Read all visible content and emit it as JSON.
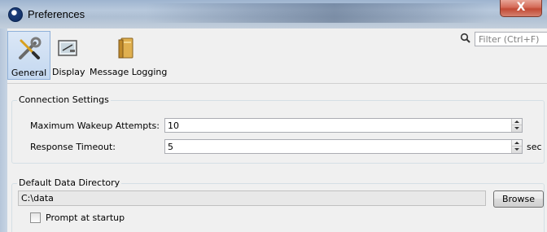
{
  "window": {
    "title": "Preferences",
    "close_glyph": "X"
  },
  "toolbar": {
    "items": [
      {
        "label": "General",
        "icon": "tools-icon",
        "selected": true
      },
      {
        "label": "Display",
        "icon": "display-icon",
        "selected": false
      },
      {
        "label": "Message Logging",
        "icon": "log-book-icon",
        "selected": false
      }
    ]
  },
  "filter": {
    "placeholder": "Filter (Ctrl+F)"
  },
  "connection": {
    "title": "Connection Settings",
    "wakeup_label": "Maximum Wakeup Attempts:",
    "wakeup_value": "10",
    "timeout_label": "Response Timeout:",
    "timeout_value": "5",
    "timeout_unit": "sec"
  },
  "data_dir": {
    "title": "Default Data Directory",
    "path": "C:\\data",
    "browse_label": "Browse",
    "prompt_label": "Prompt at startup",
    "prompt_checked": false
  },
  "colors": {
    "selection": "#c4d8f0",
    "title_bar": "#aebfd3",
    "close": "#c24a35"
  }
}
